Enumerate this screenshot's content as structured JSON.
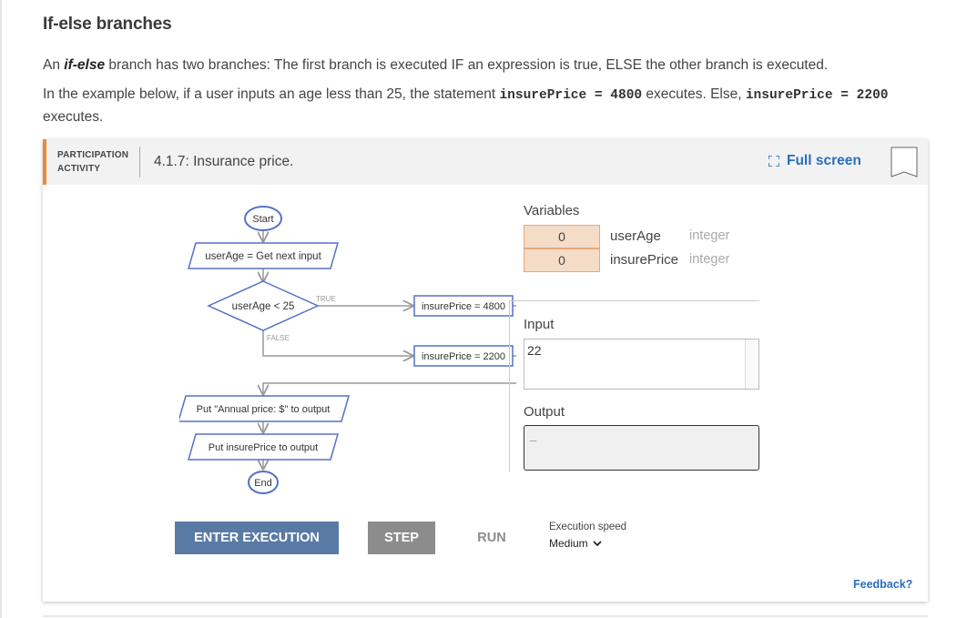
{
  "heading": "If-else branches",
  "para1": {
    "pre": "An ",
    "term": "if-else",
    "post": " branch has two branches: The first branch is executed IF an expression is true, ELSE the other branch is executed."
  },
  "para2": {
    "pre": "In the example below, if a user inputs an age less than 25, the statement ",
    "code1": "insurePrice = 4800",
    "mid": " executes. Else, ",
    "code2": "insurePrice = 2200",
    "post": " executes."
  },
  "activity": {
    "label_line1": "PARTICIPATION",
    "label_line2": "ACTIVITY",
    "title": "4.1.7: Insurance price.",
    "fullscreen_label": "Full screen"
  },
  "flowchart": {
    "start": "Start",
    "input": "userAge = Get next input",
    "decision": "userAge < 25",
    "true_label": "TRUE",
    "false_label": "FALSE",
    "true_branch": "insurePrice = 4800",
    "false_branch": "insurePrice = 2200",
    "put1": "Put \"Annual price: $\" to output",
    "put2": "Put insurePrice to output",
    "end": "End"
  },
  "variables": {
    "title": "Variables",
    "items": [
      {
        "value": "0",
        "name": "userAge",
        "type": "integer"
      },
      {
        "value": "0",
        "name": "insurePrice",
        "type": "integer"
      }
    ]
  },
  "input": {
    "title": "Input",
    "value": "22"
  },
  "output": {
    "title": "Output",
    "value": "–"
  },
  "controls": {
    "enter_label": "ENTER EXECUTION",
    "step_label": "STEP",
    "run_label": "RUN",
    "speed_label": "Execution speed",
    "speed_value": "Medium"
  },
  "feedback_label": "Feedback?",
  "colors": {
    "accent": "#e98a3b",
    "link": "#2a6ebb",
    "node_border": "#5570c8",
    "var_fill": "#f5dcc7"
  }
}
